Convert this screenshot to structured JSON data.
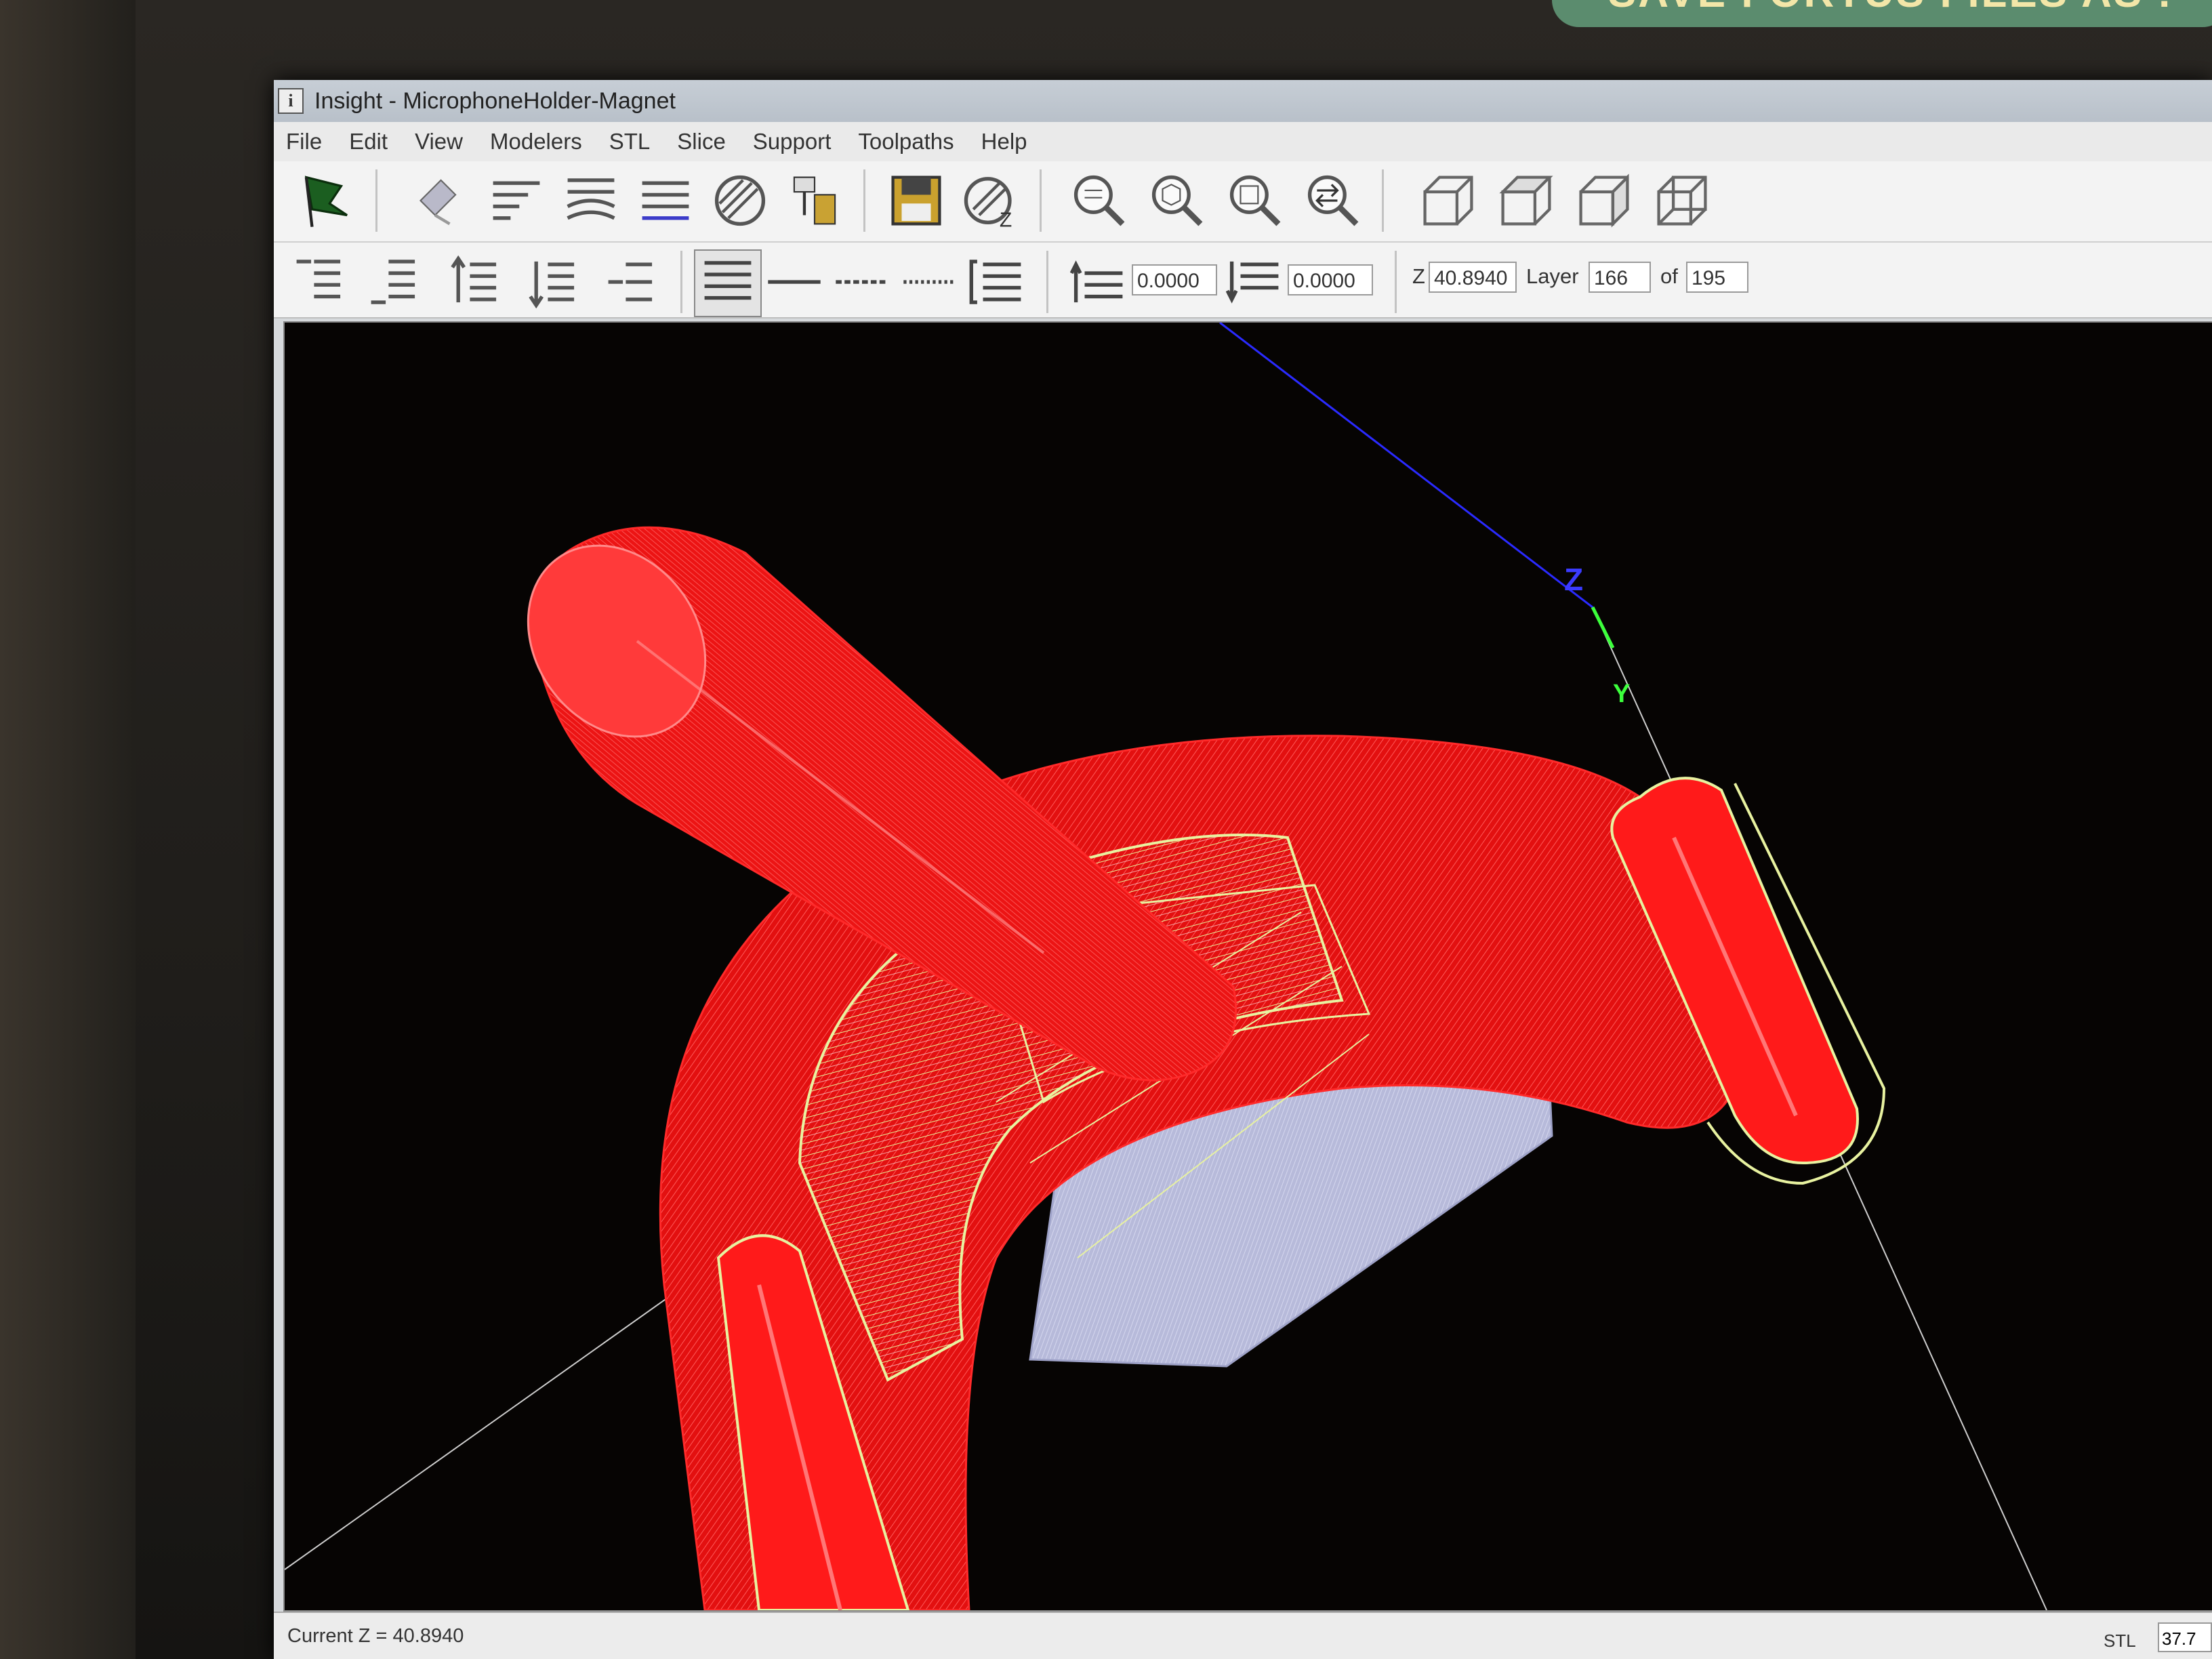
{
  "banner": {
    "text": "SAVE FORTUS FILES AS :"
  },
  "window": {
    "title": "Insight - MicrophoneHolder-Magnet"
  },
  "menu": [
    "File",
    "Edit",
    "View",
    "Modelers",
    "STL",
    "Slice",
    "Support",
    "Toolpaths",
    "Help"
  ],
  "toolbar1": {
    "icons": [
      "flag-icon",
      "orient-icon",
      "slice-align-left-icon",
      "slice-curve-icon",
      "slice-lines-icon",
      "hatch-circle-icon",
      "machine-icon",
      "save-icon",
      "z-circle-icon",
      "zoom-in-icon",
      "zoom-cube-icon",
      "zoom-box-icon",
      "zoom-swap-icon",
      "view-front-icon",
      "view-top-icon",
      "view-side-icon",
      "view-iso-icon"
    ]
  },
  "toolbar2": {
    "offset_a": "0.0000",
    "offset_b": "0.0000",
    "z_label": "Z",
    "z_value": "40.8940",
    "layer_label": "Layer",
    "layer_value": "166",
    "of_label": "of",
    "layer_total": "195"
  },
  "viewport": {
    "axis_z": "Z",
    "axis_y": "Y",
    "colors": {
      "model": "#ff1c1c",
      "toolpath": "#e8f2a0",
      "support": "#c5c8e6",
      "axis_z": "#2a2aff",
      "axis_y": "#3cff3c"
    }
  },
  "status": {
    "current_z": "Current Z = 40.8940",
    "right_label": "STL",
    "right_value": "37.7"
  }
}
